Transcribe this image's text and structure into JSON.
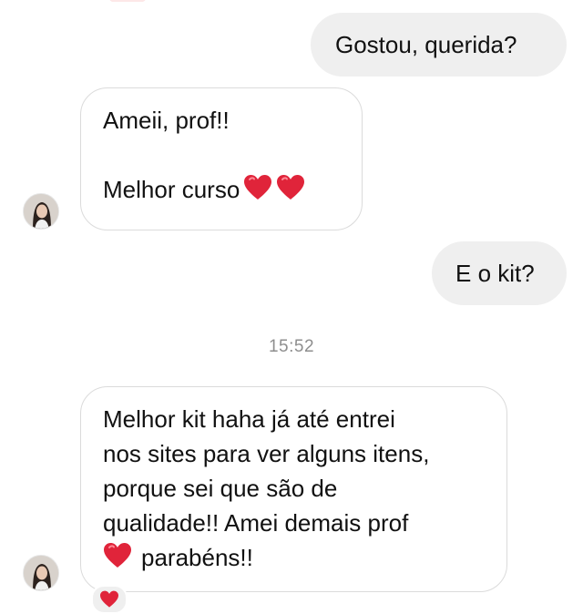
{
  "conversation": {
    "messages": [
      {
        "id": "m1",
        "direction": "outgoing",
        "lines": [
          "Gostou, querida?"
        ]
      },
      {
        "id": "m2",
        "direction": "incoming",
        "lines": [
          "Ameii, prof!!",
          "",
          "Melhor curso"
        ],
        "trailing_icons": [
          "heart-icon",
          "heart-icon"
        ]
      },
      {
        "id": "m3",
        "direction": "outgoing",
        "lines": [
          "E o kit?"
        ]
      },
      {
        "id": "m4",
        "direction": "incoming",
        "lines": [
          "Melhor kit haha já até entrei",
          "nos sites para ver alguns itens,",
          "porque sei que são de",
          "qualidade!! Amei demais prof",
          "parabéns!!"
        ],
        "leading_icon_last_line": "heart-icon",
        "reaction": "heart-icon"
      }
    ],
    "timestamp": "15:52"
  },
  "colors": {
    "outgoing_bubble": "#efefef",
    "incoming_border": "#dbdbdb",
    "heart": "#e0243a",
    "timestamp_text": "#8e8e8e"
  }
}
